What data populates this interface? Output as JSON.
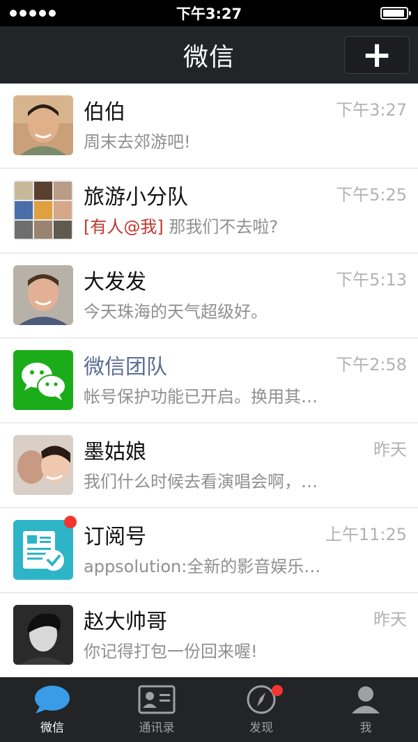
{
  "status_bar": {
    "time": "下午3:27"
  },
  "nav": {
    "title": "微信",
    "add_label": "+"
  },
  "chats": [
    {
      "name": "伯伯",
      "time": "下午3:27",
      "preview": "周末去郊游吧!",
      "avatar_icon": "person-photo"
    },
    {
      "name": "旅游小分队",
      "time": "下午5:25",
      "mention": "[有人@我]",
      "preview": "那我们不去啦?",
      "avatar_icon": "group-photo-grid"
    },
    {
      "name": "大发发",
      "time": "下午5:13",
      "preview": "今天珠海的天气超级好。",
      "avatar_icon": "person-photo"
    },
    {
      "name": "微信团队",
      "time": "下午2:58",
      "preview": "帐号保护功能已开启。换用其…",
      "avatar_icon": "wechat-logo-icon"
    },
    {
      "name": "墨姑娘",
      "time": "昨天",
      "preview": "我们什么时候去看演唱会啊，…",
      "avatar_icon": "person-photo"
    },
    {
      "name": "订阅号",
      "time": "上午11:25",
      "preview": "appsolution:全新的影音娱乐…",
      "avatar_icon": "subscription-icon"
    },
    {
      "name": "赵大帅哥",
      "time": "昨天",
      "preview": "你记得打包一份回来喔!",
      "avatar_icon": "person-photo"
    }
  ],
  "tabs": [
    {
      "label": "微信",
      "icon": "chat-bubble-icon",
      "active": true
    },
    {
      "label": "通讯录",
      "icon": "contacts-card-icon",
      "active": false
    },
    {
      "label": "发现",
      "icon": "compass-icon",
      "active": false
    },
    {
      "label": "我",
      "icon": "person-icon",
      "active": false
    }
  ],
  "colors": {
    "nav_bg": "#222528",
    "accent": "#1aad19",
    "badge": "#f43530",
    "mention": "#c0362c",
    "official_name": "#5a6c95"
  }
}
